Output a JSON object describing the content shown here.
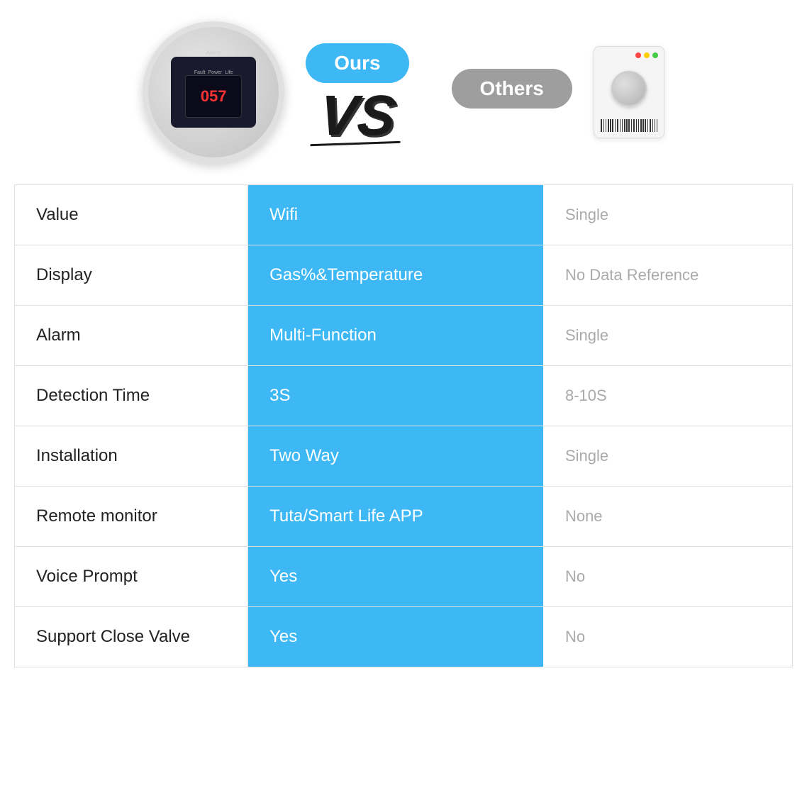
{
  "header": {
    "ours_label": "Ours",
    "vs_label": "VS",
    "others_label": "Others"
  },
  "table": {
    "rows": [
      {
        "feature": "Value",
        "ours": "Wifi",
        "others": "Single"
      },
      {
        "feature": "Display",
        "ours": "Gas%&Temperature",
        "others": "No Data Reference"
      },
      {
        "feature": "Alarm",
        "ours": "Multi-Function",
        "others": "Single"
      },
      {
        "feature": "Detection Time",
        "ours": "3S",
        "others": "8-10S"
      },
      {
        "feature": "Installation",
        "ours": "Two Way",
        "others": "Single"
      },
      {
        "feature": "Remote monitor",
        "ours": "Tuta/Smart Life APP",
        "others": "None"
      },
      {
        "feature": "Voice Prompt",
        "ours": "Yes",
        "others": "No"
      },
      {
        "feature": "Support Close Valve",
        "ours": "Yes",
        "others": "No"
      }
    ]
  }
}
